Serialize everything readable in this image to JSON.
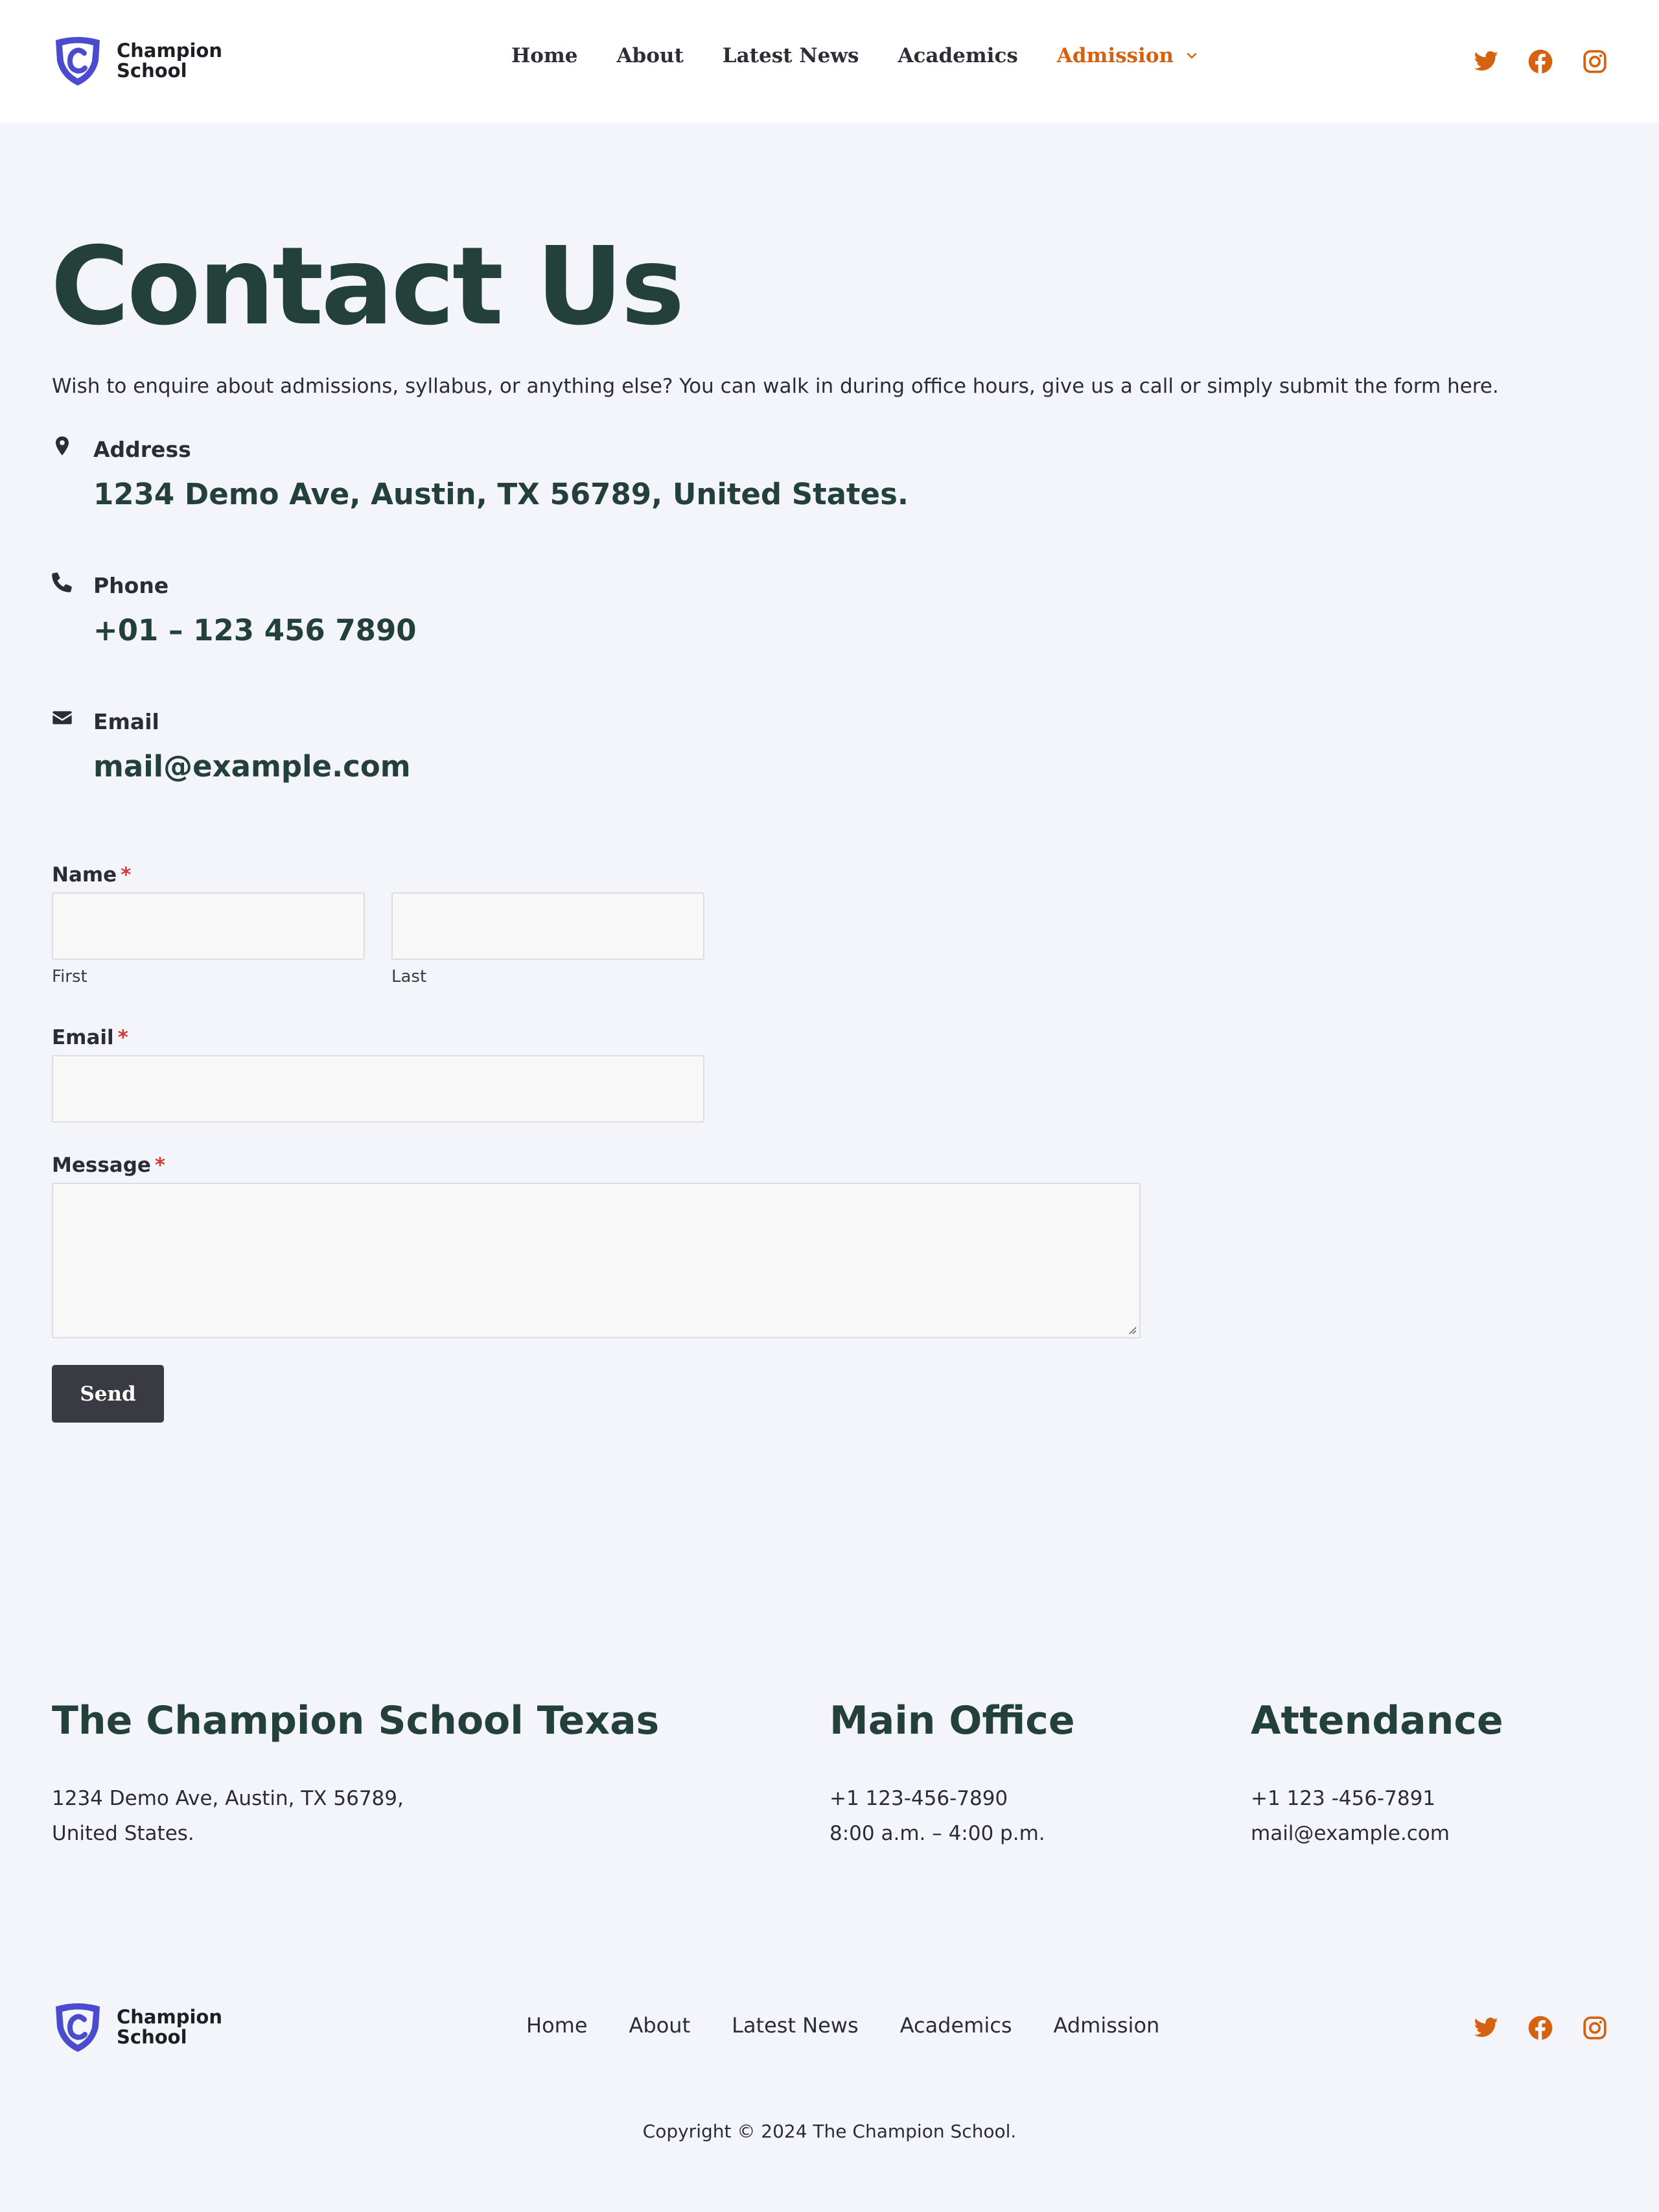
{
  "header": {
    "logo_line1": "Champion",
    "logo_line2": "School",
    "nav": [
      "Home",
      "About",
      "Latest News",
      "Academics"
    ],
    "nav_active": "Admission",
    "socials": [
      "twitter-icon",
      "facebook-icon",
      "instagram-icon"
    ]
  },
  "colors": {
    "accent": "#d4620f",
    "heading": "#24403a",
    "logo": "#4b4bd0",
    "button": "#3a3b42",
    "background": "#f4f5fb"
  },
  "hero": {
    "title": "Contact Us",
    "intro": "Wish to enquire about admissions, syllabus, or anything else? You can walk in during office hours, give us a call or simply submit the form here."
  },
  "contact": {
    "address_label": "Address",
    "address_value": "1234 Demo Ave, Austin, TX 56789, United States.",
    "phone_label": "Phone",
    "phone_value": "+01 – 123 456 7890",
    "email_label": "Email",
    "email_value": "mail@example.com"
  },
  "form": {
    "name_label": "Name",
    "required_mark": "*",
    "first_sub": "First",
    "last_sub": "Last",
    "email_label": "Email",
    "message_label": "Message",
    "send_label": "Send"
  },
  "footer": {
    "col1": {
      "heading": "The Champion School Texas",
      "line1": "1234 Demo Ave, Austin, TX 56789,",
      "line2": "United States."
    },
    "col2": {
      "heading": "Main Office",
      "line1": "+1 123-456-7890",
      "line2": "8:00 a.m. – 4:00 p.m."
    },
    "col3": {
      "heading": "Attendance",
      "line1": "+1 123 -456-7891",
      "line2": "mail@example.com"
    },
    "logo_line1": "Champion",
    "logo_line2": "School",
    "nav": [
      "Home",
      "About",
      "Latest News",
      "Academics",
      "Admission"
    ],
    "copyright": "Copyright © 2024 The Champion School."
  }
}
